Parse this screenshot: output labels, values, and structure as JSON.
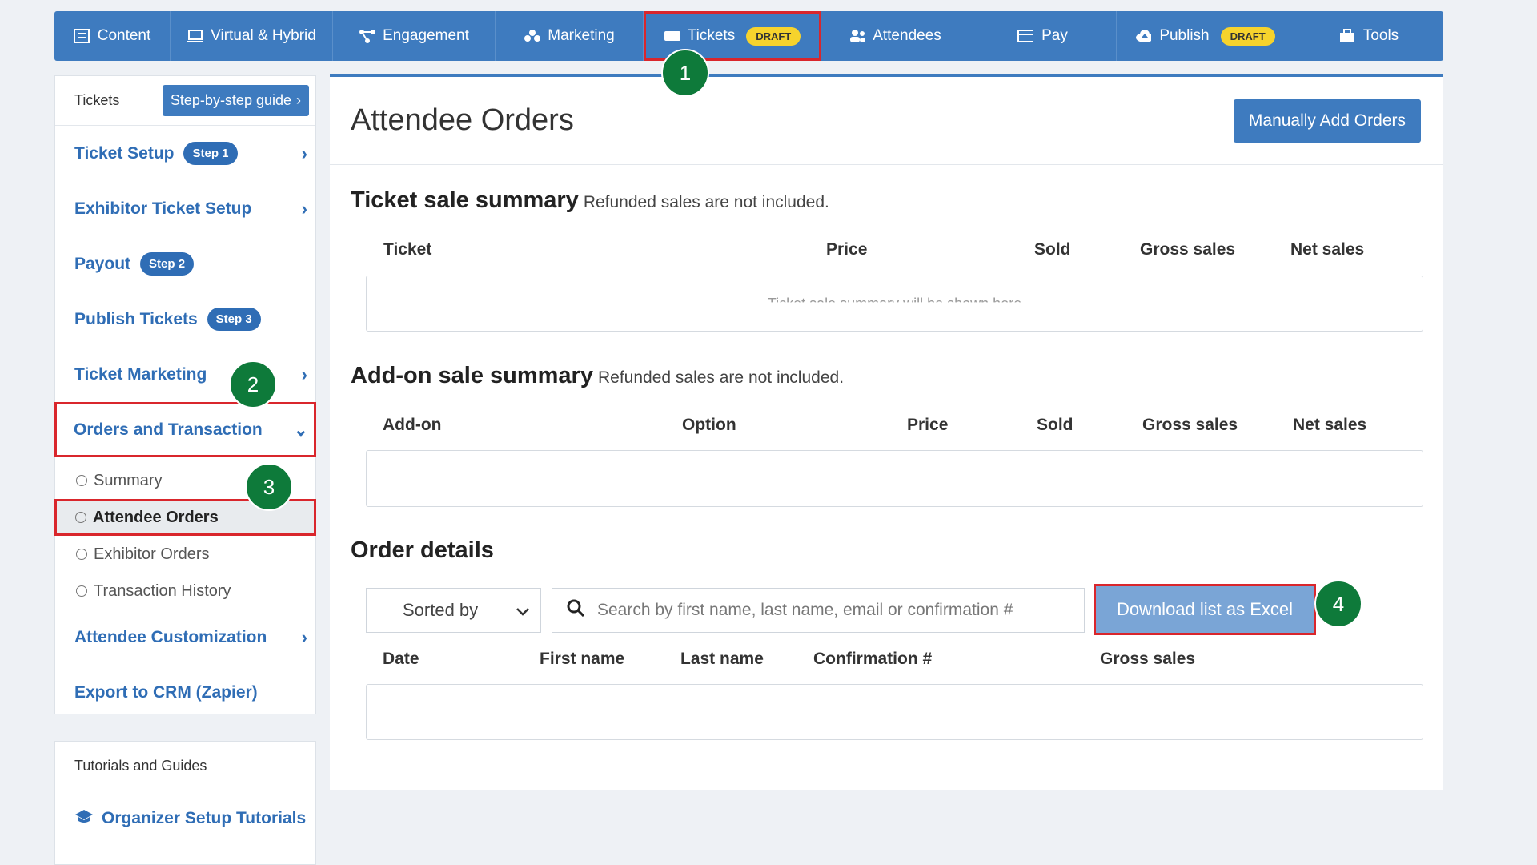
{
  "nav": {
    "items": [
      {
        "label": "Content",
        "icon": "list-icon"
      },
      {
        "label": "Virtual & Hybrid",
        "icon": "laptop-icon"
      },
      {
        "label": "Engagement",
        "icon": "network-icon"
      },
      {
        "label": "Marketing",
        "icon": "people-group-icon"
      },
      {
        "label": "Tickets",
        "icon": "ticket-icon",
        "badge": "DRAFT"
      },
      {
        "label": "Attendees",
        "icon": "users-icon"
      },
      {
        "label": "Pay",
        "icon": "credit-card-icon"
      },
      {
        "label": "Publish",
        "icon": "cloud-upload-icon",
        "badge": "DRAFT"
      },
      {
        "label": "Tools",
        "icon": "toolbox-icon"
      }
    ]
  },
  "sidebar": {
    "header_title": "Tickets",
    "guide_label": "Step-by-step guide",
    "items": [
      {
        "label": "Ticket Setup",
        "step": "Step 1"
      },
      {
        "label": "Exhibitor Ticket Setup"
      },
      {
        "label": "Payout",
        "step": "Step 2"
      },
      {
        "label": "Publish Tickets",
        "step": "Step 3"
      },
      {
        "label": "Ticket Marketing"
      },
      {
        "label": "Orders and Transaction"
      },
      {
        "label": "Attendee Customization"
      },
      {
        "label": "Export to CRM (Zapier)"
      }
    ],
    "subitems": [
      "Summary",
      "Attendee Orders",
      "Exhibitor Orders",
      "Transaction History"
    ]
  },
  "sidebar2": {
    "header_title": "Tutorials and Guides",
    "link_label": "Organizer Setup Tutorials"
  },
  "main": {
    "title": "Attendee Orders",
    "add_orders_label": "Manually Add Orders",
    "ticket_summary": {
      "title": "Ticket sale summary",
      "note": "Refunded sales are not included.",
      "columns": [
        "Ticket",
        "Price",
        "Sold",
        "Gross sales",
        "Net sales"
      ],
      "empty": "Ticket sale summary will be shown here"
    },
    "addon_summary": {
      "title": "Add-on sale summary",
      "note": "Refunded sales are not included.",
      "columns": [
        "Add-on",
        "Option",
        "Price",
        "Sold",
        "Gross sales",
        "Net sales"
      ]
    },
    "order_details": {
      "title": "Order details",
      "sorted_label": "Sorted by",
      "search_placeholder": "Search by first name, last name, email or confirmation #",
      "download_label": "Download list as Excel",
      "columns": [
        "Date",
        "First name",
        "Last name",
        "Confirmation #",
        "Gross sales"
      ]
    }
  },
  "markers": [
    "1",
    "2",
    "3",
    "4"
  ],
  "colors": {
    "accent": "#3e7bbf",
    "draft_badge": "#f6d32d",
    "marker": "#0e7a3a",
    "highlight": "#d9262c"
  }
}
